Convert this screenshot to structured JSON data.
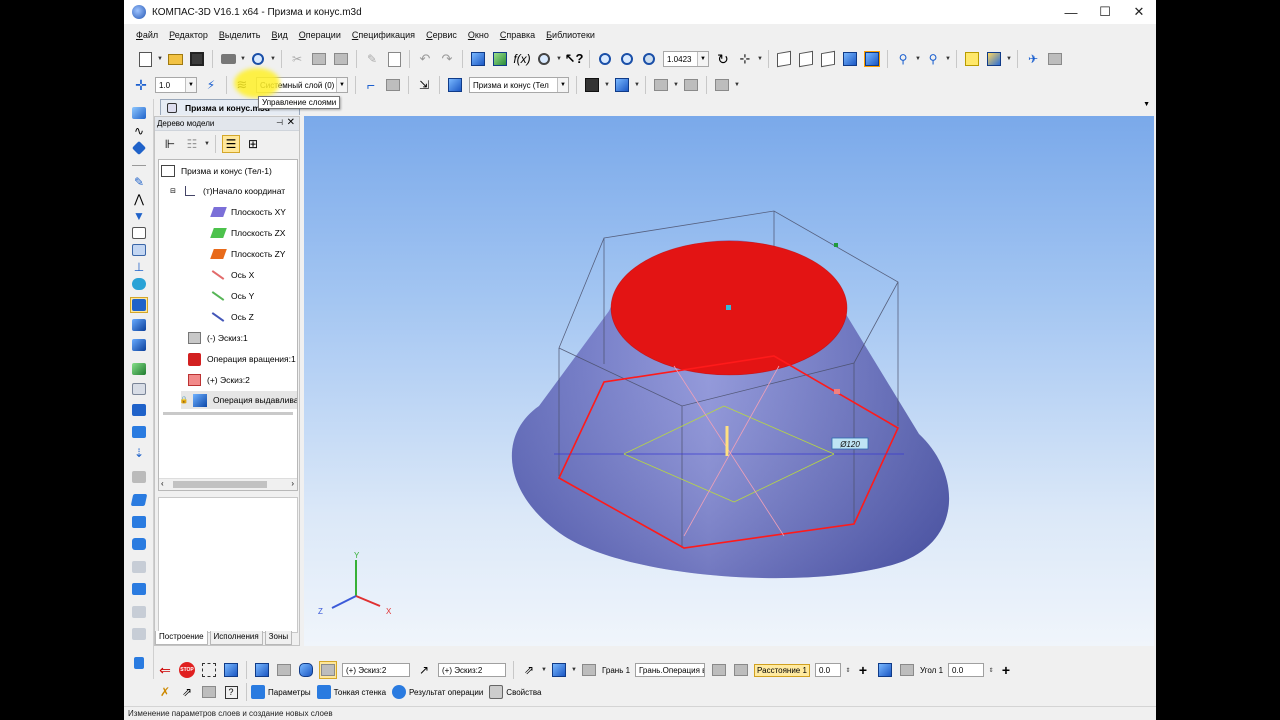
{
  "window": {
    "title": "КОМПАС-3D V16.1 x64 - Призма и конус.m3d",
    "minimize": "—",
    "maximize": "☐",
    "close": "✕"
  },
  "menu": [
    "Файл",
    "Редактор",
    "Выделить",
    "Вид",
    "Операции",
    "Спецификация",
    "Сервис",
    "Окно",
    "Справка",
    "Библиотеки"
  ],
  "toolbar1": {
    "zoom_value": "1.0423"
  },
  "toolbar2": {
    "step_value": "1.0",
    "layer_value": "Системный слой (0)",
    "object_value": "Призма и конус (Тел"
  },
  "tooltip": "Управление слоями",
  "document_tab": "Призма и конус.m3d",
  "tree": {
    "header": "Дерево модели",
    "pin": "⊣",
    "close": "✕",
    "items": [
      {
        "label": "Призма и конус (Тел-1)",
        "icon": "model-icon"
      },
      {
        "label": "(т)Начало координат",
        "icon": "origin-icon"
      },
      {
        "label": "Плоскость XY",
        "icon": "plane-xy-icon"
      },
      {
        "label": "Плоскость ZX",
        "icon": "plane-zx-icon"
      },
      {
        "label": "Плоскость ZY",
        "icon": "plane-zy-icon"
      },
      {
        "label": "Ось X",
        "icon": "axis-x-icon"
      },
      {
        "label": "Ось Y",
        "icon": "axis-y-icon"
      },
      {
        "label": "Ось Z",
        "icon": "axis-z-icon"
      },
      {
        "label": "(-) Эскиз:1",
        "icon": "sketch-icon"
      },
      {
        "label": "Операция вращения:1",
        "icon": "revolve-icon"
      },
      {
        "label": "(+) Эскиз:2",
        "icon": "sketch-icon"
      },
      {
        "label": "Операция выдавливания",
        "icon": "extrude-icon"
      }
    ],
    "tabs": [
      "Построение",
      "Исполнения",
      "Зоны"
    ]
  },
  "viewport": {
    "dimension_label": "Ø120",
    "axis_labels": {
      "x": "X",
      "y": "Y",
      "z": "Z"
    },
    "colors": {
      "cone": "#6f78c8",
      "circle": "#e81010",
      "hexagon": "#ff1a1a"
    }
  },
  "props": {
    "row1": {
      "sketch1": "(+) Эскиз:2",
      "sketch2": "(+) Эскиз:2",
      "face_label": "Грань 1",
      "face_value": "Грань.Операция в",
      "distance_label": "Расстояние 1",
      "distance_value": "0.0",
      "angle_label": "Угол 1",
      "angle_value": "0.0",
      "stop": "STOP",
      "plus": "+"
    },
    "row2": {
      "params": "Параметры",
      "thin_wall": "Тонкая стенка",
      "result": "Результат операции",
      "properties": "Свойства"
    }
  },
  "status": "Изменение параметров слоев и создание новых слоев"
}
